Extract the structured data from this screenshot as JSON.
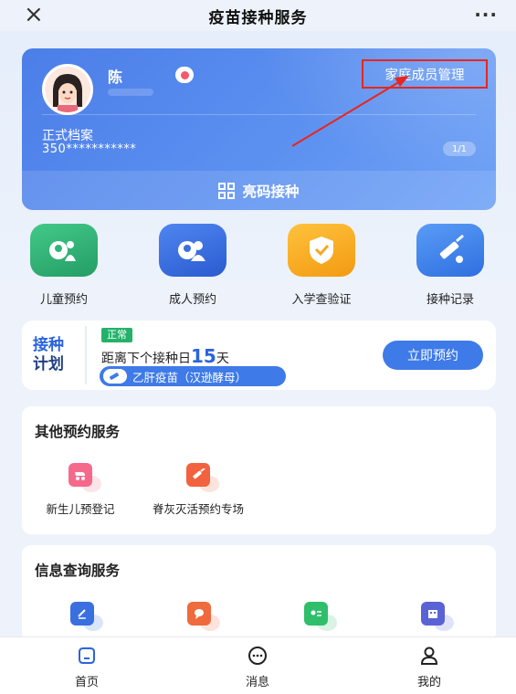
{
  "header": {
    "close_icon": "×",
    "title": "疫苗接种服务",
    "more_icon": "···"
  },
  "profile": {
    "name": "陈",
    "family_manage": "家庭成员管理",
    "archive_label": "正式档案",
    "archive_id": "350***********",
    "pager": "1/1",
    "scan_label": "亮码接种"
  },
  "quick_entries": [
    {
      "label": "儿童预约",
      "color": "#2fb57a",
      "icon": "child-icon"
    },
    {
      "label": "成人预约",
      "color": "#3a6fe0",
      "icon": "adult-icon"
    },
    {
      "label": "入学查验证",
      "color": "#f5a623",
      "icon": "shield-icon"
    },
    {
      "label": "接种记录",
      "color": "#3f86ef",
      "icon": "syringe-icon"
    }
  ],
  "plan": {
    "title_line1": "接种",
    "title_line2": "计划",
    "status": "正常",
    "countdown_prefix": "距离下个接种日",
    "countdown_days": "15",
    "countdown_suffix": "天",
    "vaccine": "乙肝疫苗（汉逊酵母）",
    "book_label": "立即预约"
  },
  "other_services": {
    "title": "其他预约服务",
    "items": [
      {
        "label": "新生儿预登记",
        "color": "#f56a8a",
        "icon": "stroller-icon"
      },
      {
        "label": "脊灰灭活预约专场",
        "color": "#f2623f",
        "icon": "vaccine-icon"
      }
    ]
  },
  "info_services": {
    "title": "信息查询服务",
    "items": [
      {
        "color": "#3a6fe0",
        "icon": "document-icon"
      },
      {
        "color": "#ef6a3c",
        "icon": "chat-icon"
      },
      {
        "color": "#2fbf6b",
        "icon": "id-card-icon"
      },
      {
        "color": "#5a63d6",
        "icon": "building-icon"
      }
    ]
  },
  "nav": [
    {
      "label": "首页",
      "icon": "home-icon"
    },
    {
      "label": "消息",
      "icon": "message-icon"
    },
    {
      "label": "我的",
      "icon": "user-icon"
    }
  ]
}
